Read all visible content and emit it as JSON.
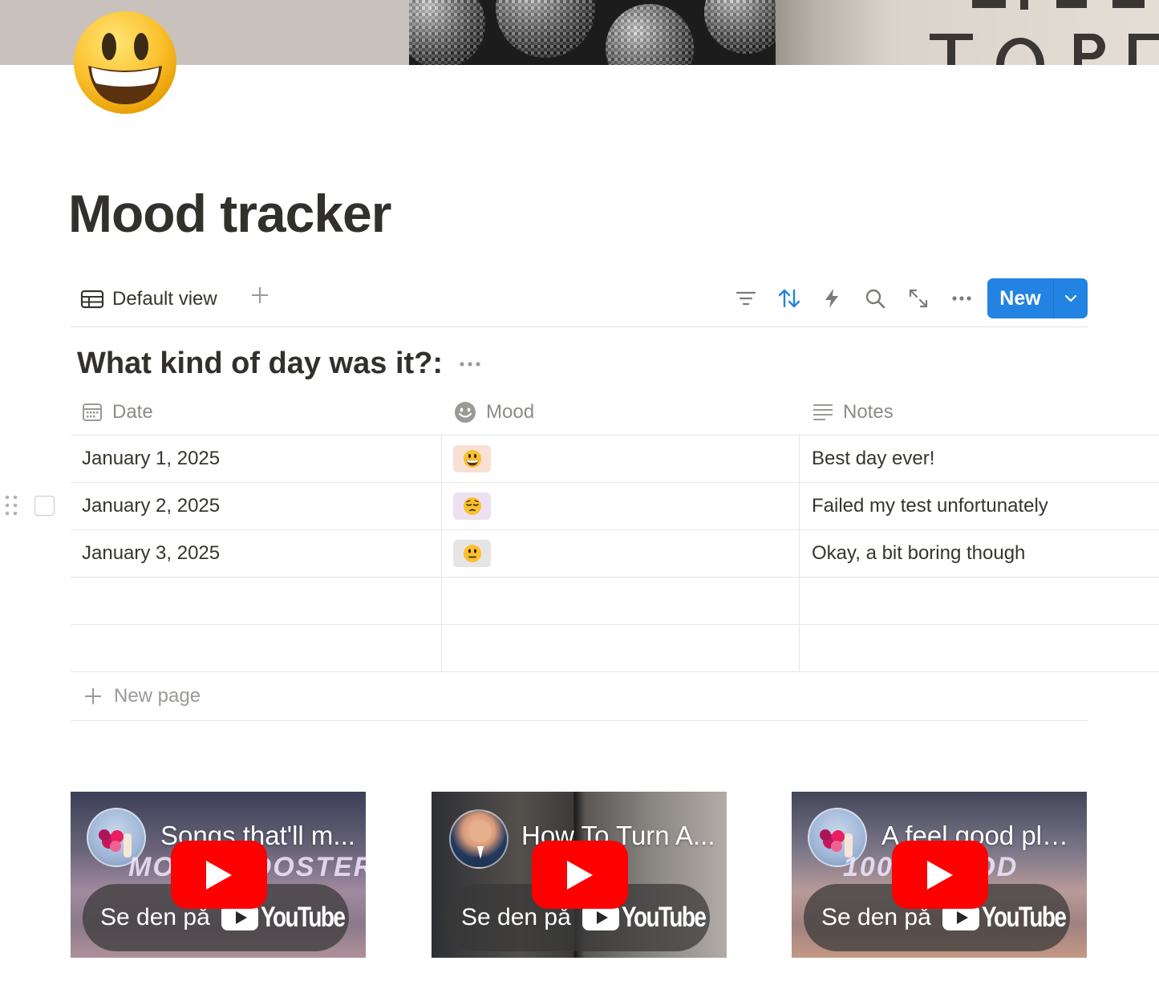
{
  "page": {
    "title": "Mood tracker",
    "icon": "grinning-face-emoji"
  },
  "view": {
    "tab_label": "Default view",
    "tab_icon": "table-icon",
    "new_button_label": "New",
    "toolbar_icons": [
      "filter-icon",
      "sort-icon",
      "automation-icon",
      "search-icon",
      "expand-icon",
      "more-icon"
    ],
    "accent_color": "#2383e2",
    "sort_active_color": "#2383e2"
  },
  "database": {
    "title": "What kind of day was it?:",
    "columns": [
      {
        "label": "Date",
        "icon": "calendar-icon"
      },
      {
        "label": "Mood",
        "icon": "smiley-icon"
      },
      {
        "label": "Notes",
        "icon": "text-lines-icon"
      }
    ],
    "rows": [
      {
        "date": "January 1, 2025",
        "mood": "😃",
        "mood_color": "#f8e0d4",
        "notes": "Best day ever!"
      },
      {
        "date": "January 2, 2025",
        "mood": "😔",
        "mood_color": "#ede1f1",
        "notes": "Failed my test unfortunately"
      },
      {
        "date": "January 3, 2025",
        "mood": "😐",
        "mood_color": "#e6e5e3",
        "notes": "Okay, a bit boring though"
      }
    ],
    "new_page_label": "New page"
  },
  "videos": [
    {
      "title": "Songs that'll m...",
      "overlay": "MOOD BOOSTER",
      "watch_text": "Se den på",
      "brand": "YouTube"
    },
    {
      "title": "How To Turn A...",
      "overlay": "",
      "watch_text": "Se den på",
      "brand": "YouTube"
    },
    {
      "title": "A feel good pla...",
      "overlay": "100% GOOD",
      "watch_text": "Se den på",
      "brand": "YouTube"
    }
  ]
}
